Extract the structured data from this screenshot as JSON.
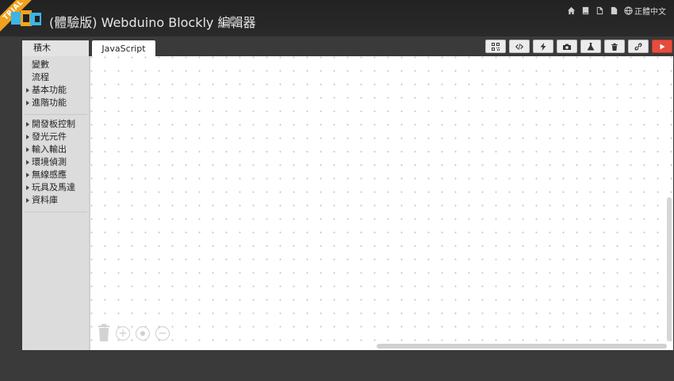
{
  "header": {
    "trial_badge": "TRIAL",
    "title": "(體驗版) Webduino Blockly 編輯器",
    "language": "正體中文",
    "icons": [
      "home-icon",
      "book-icon",
      "file-icon",
      "document-icon",
      "globe-icon"
    ]
  },
  "toolbox": {
    "title": "積木",
    "items": [
      {
        "label": "變數",
        "caret": false
      },
      {
        "label": "流程",
        "caret": false
      },
      {
        "label": "基本功能",
        "caret": true
      },
      {
        "label": "進階功能",
        "caret": true
      }
    ],
    "items2": [
      {
        "label": "開發板控制",
        "caret": true
      },
      {
        "label": "發光元件",
        "caret": true
      },
      {
        "label": "輸入輸出",
        "caret": true
      },
      {
        "label": "環境偵測",
        "caret": true
      },
      {
        "label": "無線感應",
        "caret": true
      },
      {
        "label": "玩具及馬達",
        "caret": true
      },
      {
        "label": "資料庫",
        "caret": true
      }
    ]
  },
  "tabs": {
    "javascript": "JavaScript"
  },
  "toolbar_buttons": [
    "qrcode-icon",
    "code-icon",
    "lightning-icon",
    "camera-icon",
    "flask-icon",
    "trash-icon",
    "link-icon",
    "play-icon"
  ],
  "colors": {
    "trial_badge": "#f0a21c",
    "run_button": "#e74c3c",
    "header_bg": "#222222",
    "page_bg": "#3a3a3a"
  }
}
